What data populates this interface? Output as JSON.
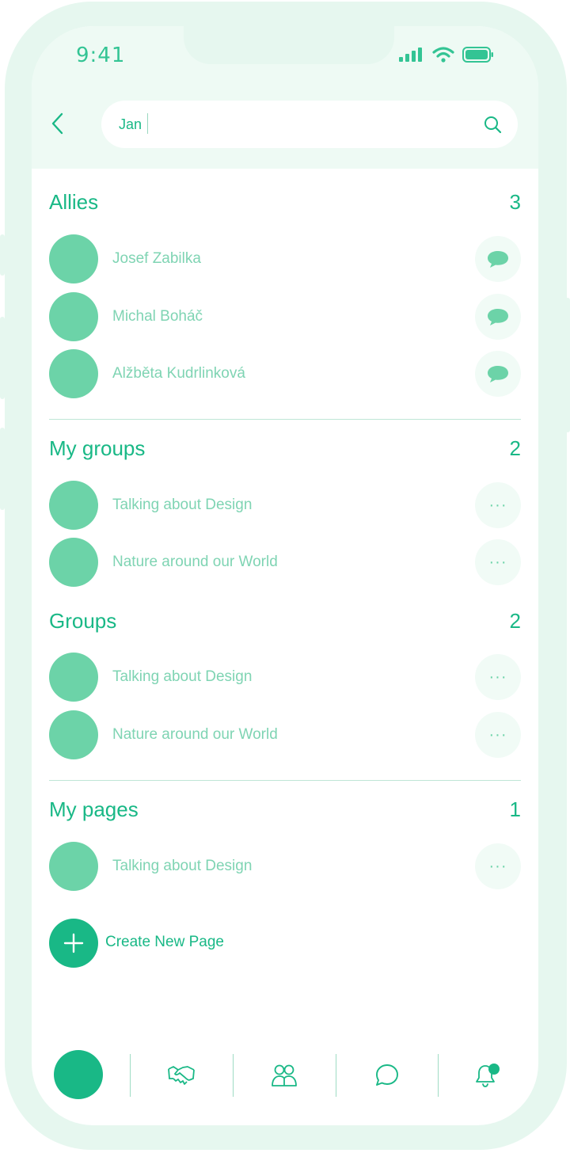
{
  "status_bar": {
    "time": "9:41"
  },
  "search": {
    "value": "Jan",
    "placeholder": ""
  },
  "sections": {
    "allies": {
      "title": "Allies",
      "count": "3",
      "items": [
        {
          "name": "Josef Zabilka",
          "action_icon": "chat-bubble-icon"
        },
        {
          "name": "Michal Boháč",
          "action_icon": "chat-bubble-icon"
        },
        {
          "name": "Alžběta Kudrlinková",
          "action_icon": "chat-bubble-icon"
        }
      ]
    },
    "my_groups": {
      "title": "My groups",
      "count": "2",
      "items": [
        {
          "name": "Talking about Design",
          "action_label": "···"
        },
        {
          "name": "Nature around our World",
          "action_label": "···"
        }
      ]
    },
    "groups": {
      "title": "Groups",
      "count": "2",
      "items": [
        {
          "name": "Talking about Design",
          "action_label": "···"
        },
        {
          "name": "Nature around our World",
          "action_label": "···"
        }
      ]
    },
    "my_pages": {
      "title": "My pages",
      "count": "1",
      "items": [
        {
          "name": "Talking about Design",
          "action_label": "···"
        }
      ]
    }
  },
  "create_page": {
    "label": "Create New Page"
  },
  "tabbar": {
    "tabs": [
      "profile-avatar",
      "handshake-icon",
      "groups-icon",
      "chat-icon",
      "bell-notification-icon"
    ]
  },
  "colors": {
    "accent": "#19b886",
    "avatar": "#6cd3a8",
    "label": "#7fd4b3",
    "frame": "#e6f7ef",
    "header_bg": "#eefaf4"
  }
}
